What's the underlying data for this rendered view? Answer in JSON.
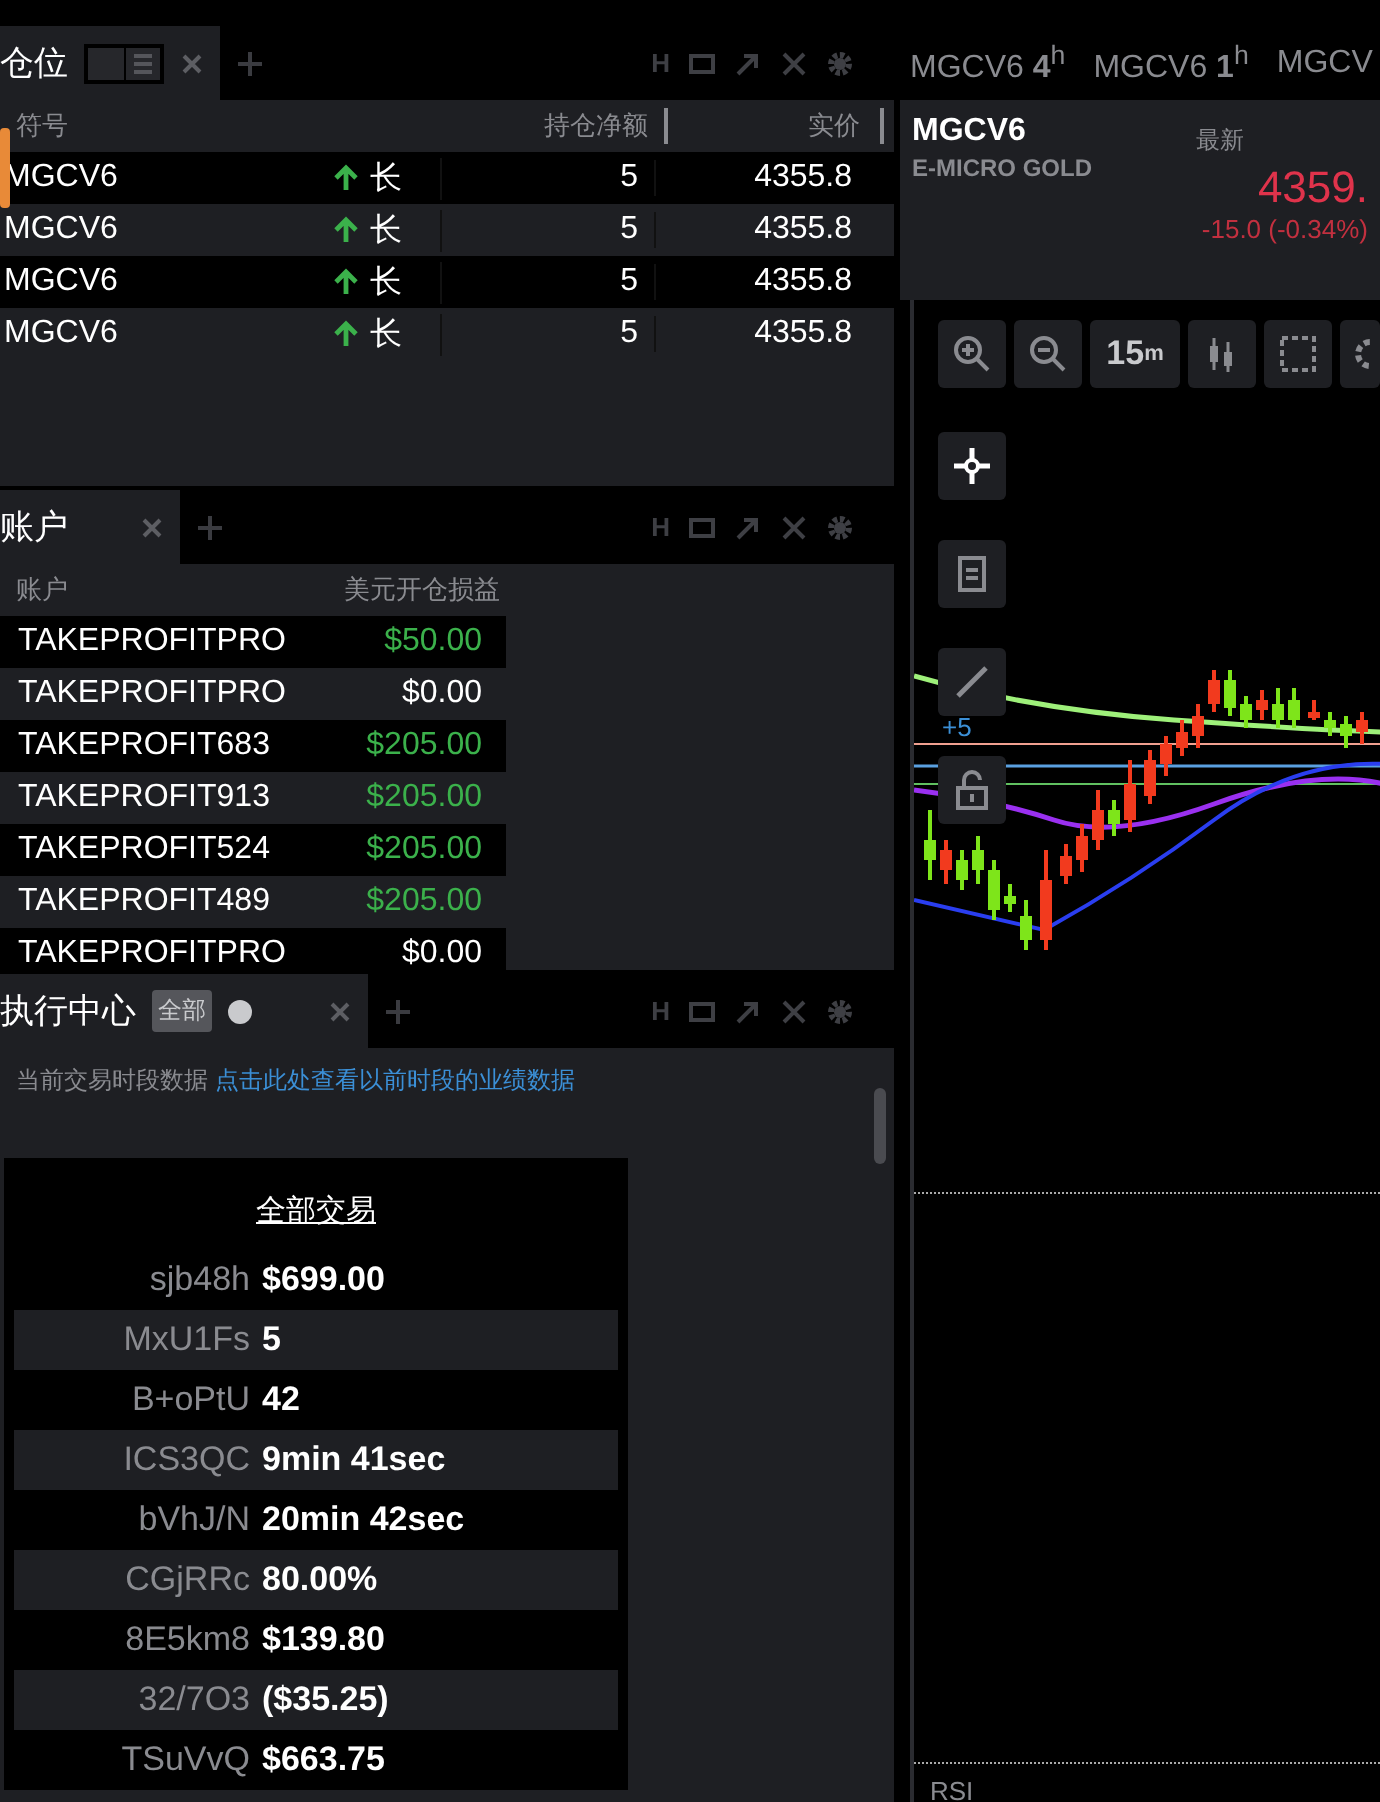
{
  "positions_panel": {
    "tab": {
      "label": "仓位"
    },
    "header_glyph": "H",
    "columns": [
      "符号",
      "持仓净额",
      "实价"
    ],
    "rows": [
      {
        "symbol": "MGCV6",
        "direction": "长",
        "quantity": "5",
        "price": "4355.8"
      },
      {
        "symbol": "MGCV6",
        "direction": "长",
        "quantity": "5",
        "price": "4355.8"
      },
      {
        "symbol": "MGCV6",
        "direction": "长",
        "quantity": "5",
        "price": "4355.8"
      },
      {
        "symbol": "MGCV6",
        "direction": "长",
        "quantity": "5",
        "price": "4355.8"
      }
    ]
  },
  "account_panel": {
    "tab": {
      "label": "账户"
    },
    "header_glyph": "H",
    "columns": [
      "账户",
      "美元开仓损益"
    ],
    "rows": [
      {
        "account": "TAKEPROFITPRO",
        "pnl": "$50.00",
        "positive": true
      },
      {
        "account": "TAKEPROFITPRO",
        "pnl": "$0.00",
        "positive": false
      },
      {
        "account": "TAKEPROFIT683",
        "pnl": "$205.00",
        "positive": true
      },
      {
        "account": "TAKEPROFIT913",
        "pnl": "$205.00",
        "positive": true
      },
      {
        "account": "TAKEPROFIT524",
        "pnl": "$205.00",
        "positive": true
      },
      {
        "account": "TAKEPROFIT489",
        "pnl": "$205.00",
        "positive": true
      },
      {
        "account": "TAKEPROFITPRO",
        "pnl": "$0.00",
        "positive": false
      }
    ]
  },
  "execution_panel": {
    "tab": {
      "label": "执行中心",
      "badge": "全部"
    },
    "header_glyph": "H",
    "info": "当前交易时段数据",
    "link": "点击此处查看以前时段的业绩数据",
    "card_title": "全部交易",
    "stats": [
      {
        "label": "sjb48h",
        "value": "$699.00"
      },
      {
        "label": "MxU1Fs",
        "value": "5"
      },
      {
        "label": "B+oPtU",
        "value": "42"
      },
      {
        "label": "ICS3QC",
        "value": "9min 41sec"
      },
      {
        "label": "bVhJ/N",
        "value": "20min 42sec"
      },
      {
        "label": "CGjRRc",
        "value": "80.00%"
      },
      {
        "label": "8E5km8",
        "value": "$139.80"
      },
      {
        "label": "32/7O3",
        "value": "($35.25)"
      },
      {
        "label": "TSuVvQ",
        "value": "$663.75"
      }
    ]
  },
  "chart_tabs": [
    {
      "symbol": "MGCV6",
      "interval": "4",
      "unit": "h"
    },
    {
      "symbol": "MGCV6",
      "interval": "1",
      "unit": "h"
    },
    {
      "symbol": "MGCV"
    }
  ],
  "quote": {
    "symbol": "MGCV6",
    "name": "E-MICRO GOLD",
    "last_label": "最新",
    "last": "4359.",
    "change": "-15.0 (-0.34%)"
  },
  "chart_toolbar": {
    "interval": "15",
    "unit": "m"
  },
  "chart_labels": {
    "line_label": "+5",
    "pane_label": "RSI"
  }
}
